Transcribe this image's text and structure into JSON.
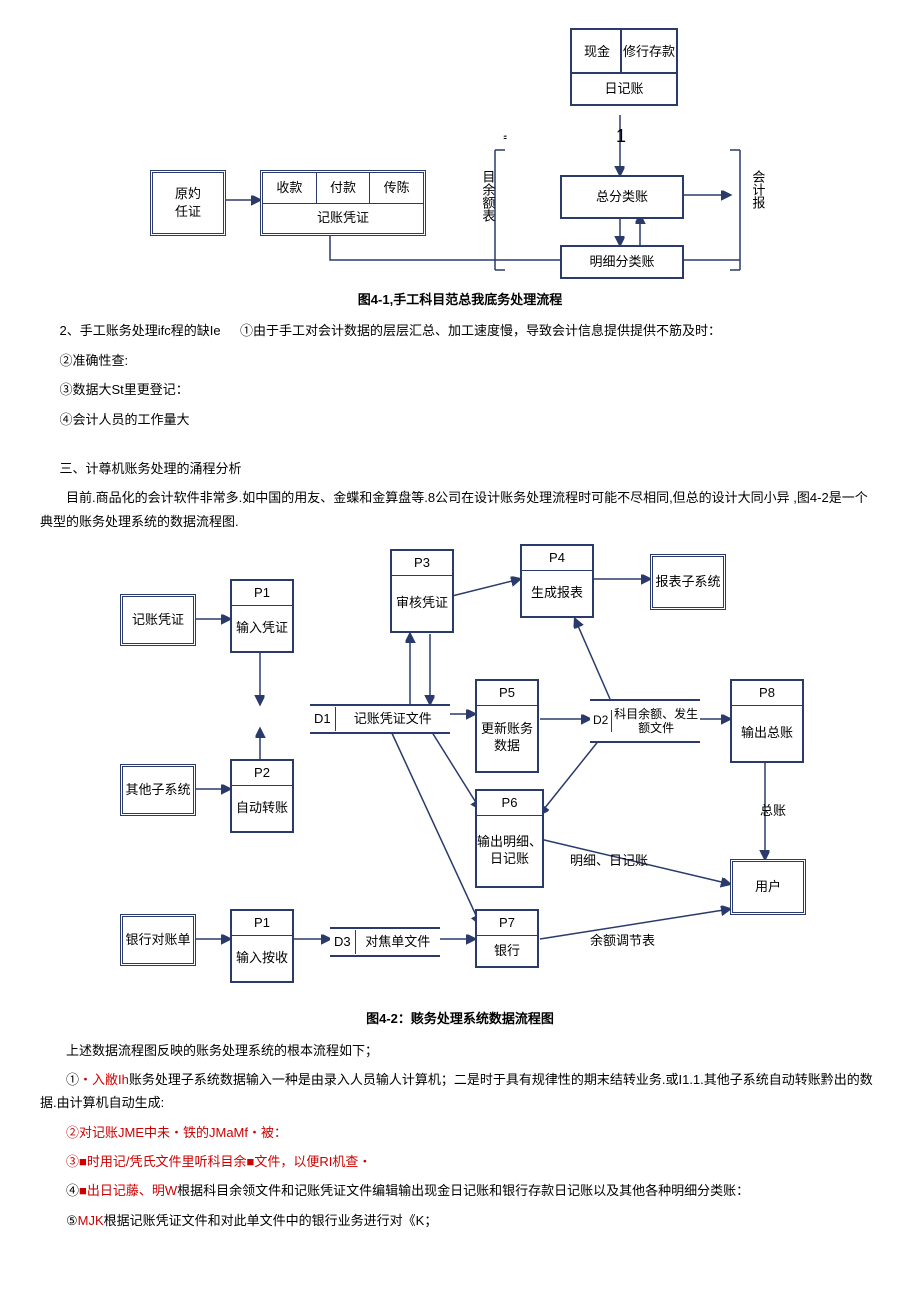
{
  "fig1": {
    "box_cash": "现金",
    "box_deposit": "修行存款",
    "box_journal": "日记账",
    "box_source": "原妁",
    "box_source2": "任证",
    "box_receipt": "收款",
    "box_payment": "付款",
    "box_transfer": "传陈",
    "box_voucher": "记账凭证",
    "box_general": "总分类账",
    "box_detail": "明细分类账",
    "label_trial": "目余额表",
    "label_report": "会计报",
    "label_one": "1",
    "label_quote": "\"",
    "caption": "图4-1,手工科目范总我底务处理流程"
  },
  "text1": {
    "line1a": "2、手工账务处理ifc程的缺Ie",
    "line1b": "①由于手工对会计数据的层层汇总、加工速度慢，导致会计信息提供提供不筋及时：",
    "line2": "②准确性查:",
    "line3": "③数据大St里更登记：",
    "line4": "④会计人员的工作量大"
  },
  "section3": {
    "title": "三、计尊机账务处理的涌程分析",
    "para": "目前.商品化的会计软件非常多.如中国的用友、金蝶和金算盘等.8公司在设计账务处理流程时可能不尽相同,但总的设计大同小异 ,图4-2是一个典型的账务处理系统的数据流程图."
  },
  "fig2": {
    "p1": "P1",
    "p1_text": "输入凭证",
    "p2": "P2",
    "p2_text": "自动转账",
    "p3": "P3",
    "p3_text": "审核凭证",
    "p4": "P4",
    "p4_text": "生成报表",
    "p5": "P5",
    "p5_text": "更新账务数据",
    "p6": "P6",
    "p6_text": "输出明细、日记账",
    "p7": "P7",
    "p7_text": "银行",
    "p8": "P8",
    "p8_text": "输出总账",
    "p1b": "P1",
    "p1b_text": "输入按收",
    "d1": "D1",
    "d1_text": "记账凭证文件",
    "d2": "D2",
    "d2_text": "科目余额、发生额文件",
    "d3": "D3",
    "d3_text": "对焦单文件",
    "src_voucher": "记账凭证",
    "src_other": "其他子系统",
    "src_bank": "银行对账单",
    "dst_report": "报表子系统",
    "dst_user": "用户",
    "lbl_general": "总账",
    "lbl_detail": "明细、日记账",
    "lbl_balance": "余额调节表",
    "caption": "图4-2：赅务处理系统数据流程图"
  },
  "text2": {
    "intro": "上述数据流程图反映的账务处理系统的根本流程如下；",
    "l1a": "①",
    "l1b": "・入敝Ih",
    "l1c": "账务处理子系统数据输入一种是由录入人员输人计算机；二是时于具有规律性的期末结转业务.或I1.1.其他子系统自动转账黔出的数据.由计算机自动生成:",
    "l2": "②对记账JME中未・铁的JMaMf・被：",
    "l3": "③■时用记/凭氏文件里听科目余■文件，以便RI机查・",
    "l4a": "④",
    "l4b": "■出日记藤、明W",
    "l4c": "根据科目余领文件和记账凭证文件编辑输出现金日记账和银行存款日记账以及其他各种明细分类账：",
    "l5a": "⑤",
    "l5b": "MJK",
    "l5c": "根据记账凭证文件和对此单文件中的银行业务进行对《K；"
  }
}
